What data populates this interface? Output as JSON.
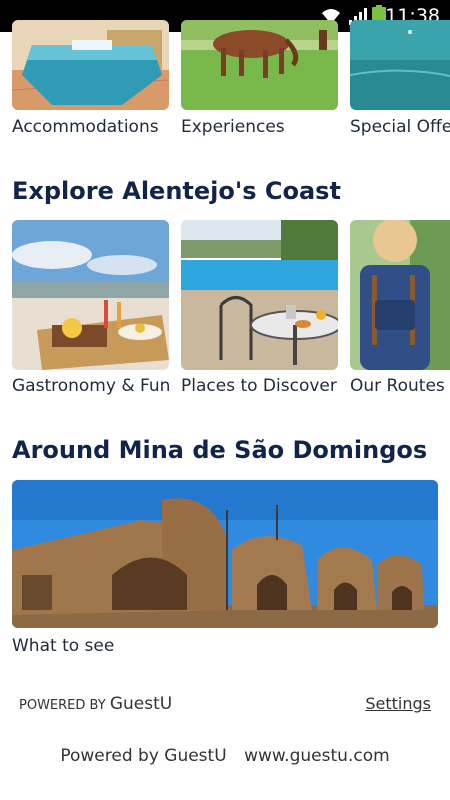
{
  "status_bar": {
    "time": "11:38"
  },
  "top_row": {
    "items": [
      {
        "label": "Accommodations"
      },
      {
        "label": "Experiences"
      },
      {
        "label": "Special Offe"
      }
    ]
  },
  "coast": {
    "title": "Explore Alentejo's Coast",
    "items": [
      {
        "label": "Gastronomy & Fun"
      },
      {
        "label": "Places to Discover"
      },
      {
        "label": "Our Routes"
      }
    ]
  },
  "mina": {
    "title": "Around Mina de São Domingos",
    "item_label": "What to see"
  },
  "powered_bar": {
    "prefix": "POWERED BY",
    "brand": "GuestU",
    "settings": "Settings"
  },
  "footer": {
    "powered": "Powered by GuestU",
    "url": "www.guestu.com"
  }
}
